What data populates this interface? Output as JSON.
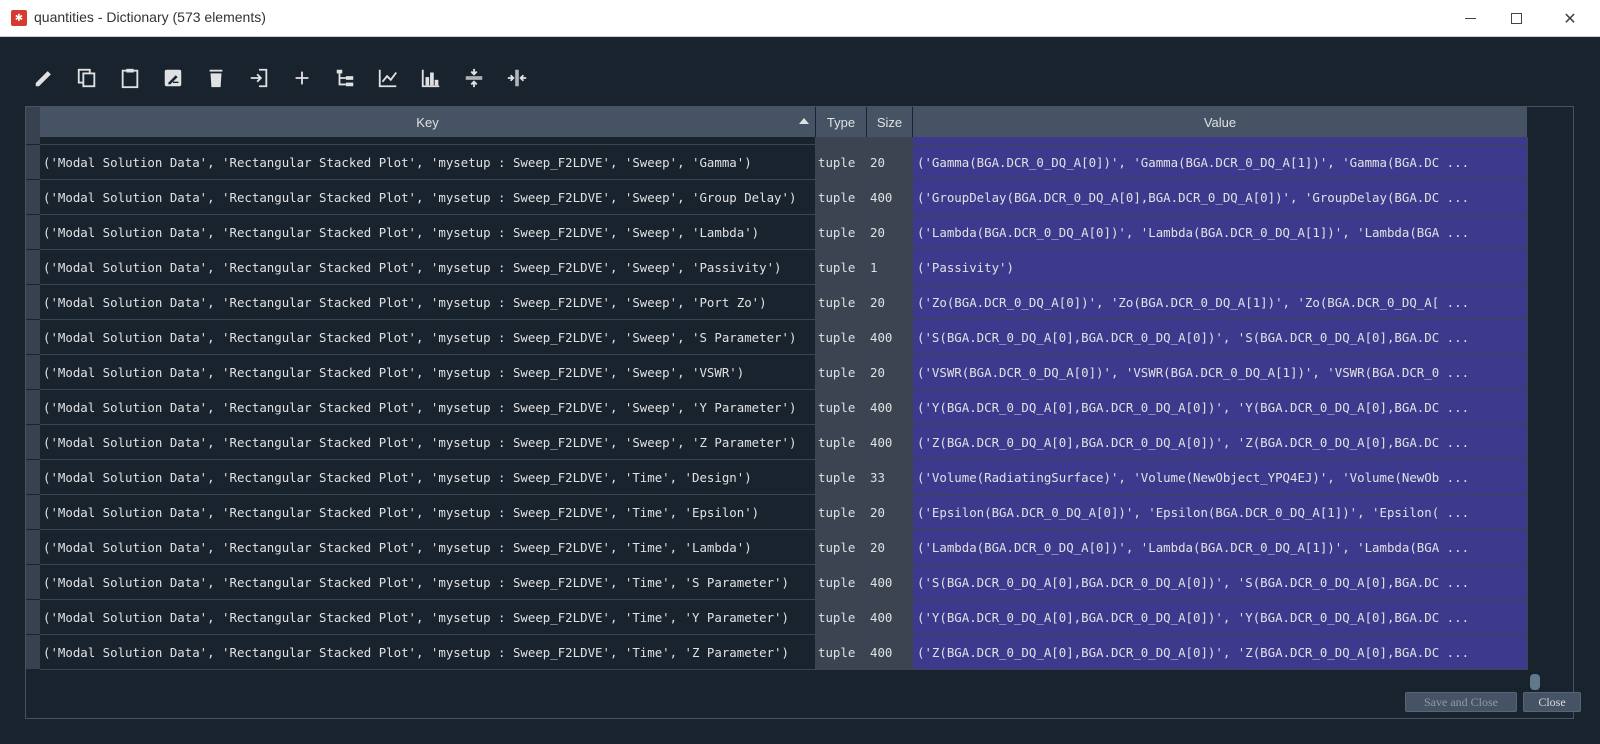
{
  "window": {
    "title": "quantities - Dictionary (573 elements)",
    "icon": "spyder-logo-icon",
    "controls": [
      "minimize",
      "maximize",
      "close"
    ]
  },
  "toolbar": {
    "buttons": [
      {
        "name": "edit",
        "icon": "pencil-icon"
      },
      {
        "name": "copy",
        "icon": "copy-icon"
      },
      {
        "name": "paste",
        "icon": "clipboard-icon"
      },
      {
        "name": "rename",
        "icon": "rename-icon"
      },
      {
        "name": "remove",
        "icon": "trash-icon"
      },
      {
        "name": "insert",
        "icon": "import-icon"
      },
      {
        "name": "add",
        "icon": "plus-icon"
      },
      {
        "name": "tree",
        "icon": "tree-icon"
      },
      {
        "name": "plot",
        "icon": "line-chart-icon"
      },
      {
        "name": "histogram",
        "icon": "histogram-icon"
      },
      {
        "name": "collapse-rows",
        "icon": "vertical-resize-icon"
      },
      {
        "name": "collapse-columns",
        "icon": "horizontal-resize-icon"
      }
    ]
  },
  "table": {
    "columns": [
      "Key",
      "Type",
      "Size",
      "Value"
    ],
    "sort_column": "Key",
    "sort_order": "ascending",
    "rows": [
      {
        "key": "('Modal Solution Data', 'Rectangular Stacked Plot', 'mysetup : Sweep_F2LDVE', 'Sweep', 'Gamma')",
        "type": "tuple",
        "size": "20",
        "value": "('Gamma(BGA.DCR_0_DQ_A[0])', 'Gamma(BGA.DCR_0_DQ_A[1])', 'Gamma(BGA.DC ..."
      },
      {
        "key": "('Modal Solution Data', 'Rectangular Stacked Plot', 'mysetup : Sweep_F2LDVE', 'Sweep', 'Group Delay')",
        "type": "tuple",
        "size": "400",
        "value": "('GroupDelay(BGA.DCR_0_DQ_A[0],BGA.DCR_0_DQ_A[0])', 'GroupDelay(BGA.DC ..."
      },
      {
        "key": "('Modal Solution Data', 'Rectangular Stacked Plot', 'mysetup : Sweep_F2LDVE', 'Sweep', 'Lambda')",
        "type": "tuple",
        "size": "20",
        "value": "('Lambda(BGA.DCR_0_DQ_A[0])', 'Lambda(BGA.DCR_0_DQ_A[1])', 'Lambda(BGA ..."
      },
      {
        "key": "('Modal Solution Data', 'Rectangular Stacked Plot', 'mysetup : Sweep_F2LDVE', 'Sweep', 'Passivity')",
        "type": "tuple",
        "size": "1",
        "value": "('Passivity')"
      },
      {
        "key": "('Modal Solution Data', 'Rectangular Stacked Plot', 'mysetup : Sweep_F2LDVE', 'Sweep', 'Port Zo')",
        "type": "tuple",
        "size": "20",
        "value": "('Zo(BGA.DCR_0_DQ_A[0])', 'Zo(BGA.DCR_0_DQ_A[1])', 'Zo(BGA.DCR_0_DQ_A[ ..."
      },
      {
        "key": "('Modal Solution Data', 'Rectangular Stacked Plot', 'mysetup : Sweep_F2LDVE', 'Sweep', 'S Parameter')",
        "type": "tuple",
        "size": "400",
        "value": "('S(BGA.DCR_0_DQ_A[0],BGA.DCR_0_DQ_A[0])', 'S(BGA.DCR_0_DQ_A[0],BGA.DC ..."
      },
      {
        "key": "('Modal Solution Data', 'Rectangular Stacked Plot', 'mysetup : Sweep_F2LDVE', 'Sweep', 'VSWR')",
        "type": "tuple",
        "size": "20",
        "value": "('VSWR(BGA.DCR_0_DQ_A[0])', 'VSWR(BGA.DCR_0_DQ_A[1])', 'VSWR(BGA.DCR_0 ..."
      },
      {
        "key": "('Modal Solution Data', 'Rectangular Stacked Plot', 'mysetup : Sweep_F2LDVE', 'Sweep', 'Y Parameter')",
        "type": "tuple",
        "size": "400",
        "value": "('Y(BGA.DCR_0_DQ_A[0],BGA.DCR_0_DQ_A[0])', 'Y(BGA.DCR_0_DQ_A[0],BGA.DC ..."
      },
      {
        "key": "('Modal Solution Data', 'Rectangular Stacked Plot', 'mysetup : Sweep_F2LDVE', 'Sweep', 'Z Parameter')",
        "type": "tuple",
        "size": "400",
        "value": "('Z(BGA.DCR_0_DQ_A[0],BGA.DCR_0_DQ_A[0])', 'Z(BGA.DCR_0_DQ_A[0],BGA.DC ..."
      },
      {
        "key": "('Modal Solution Data', 'Rectangular Stacked Plot', 'mysetup : Sweep_F2LDVE', 'Time', 'Design')",
        "type": "tuple",
        "size": "33",
        "value": "('Volume(RadiatingSurface)', 'Volume(NewObject_YPQ4EJ)', 'Volume(NewOb ..."
      },
      {
        "key": "('Modal Solution Data', 'Rectangular Stacked Plot', 'mysetup : Sweep_F2LDVE', 'Time', 'Epsilon')",
        "type": "tuple",
        "size": "20",
        "value": "('Epsilon(BGA.DCR_0_DQ_A[0])', 'Epsilon(BGA.DCR_0_DQ_A[1])', 'Epsilon( ..."
      },
      {
        "key": "('Modal Solution Data', 'Rectangular Stacked Plot', 'mysetup : Sweep_F2LDVE', 'Time', 'Lambda')",
        "type": "tuple",
        "size": "20",
        "value": "('Lambda(BGA.DCR_0_DQ_A[0])', 'Lambda(BGA.DCR_0_DQ_A[1])', 'Lambda(BGA ..."
      },
      {
        "key": "('Modal Solution Data', 'Rectangular Stacked Plot', 'mysetup : Sweep_F2LDVE', 'Time', 'S Parameter')",
        "type": "tuple",
        "size": "400",
        "value": "('S(BGA.DCR_0_DQ_A[0],BGA.DCR_0_DQ_A[0])', 'S(BGA.DCR_0_DQ_A[0],BGA.DC ..."
      },
      {
        "key": "('Modal Solution Data', 'Rectangular Stacked Plot', 'mysetup : Sweep_F2LDVE', 'Time', 'Y Parameter')",
        "type": "tuple",
        "size": "400",
        "value": "('Y(BGA.DCR_0_DQ_A[0],BGA.DCR_0_DQ_A[0])', 'Y(BGA.DCR_0_DQ_A[0],BGA.DC ..."
      },
      {
        "key": "('Modal Solution Data', 'Rectangular Stacked Plot', 'mysetup : Sweep_F2LDVE', 'Time', 'Z Parameter')",
        "type": "tuple",
        "size": "400",
        "value": "('Z(BGA.DCR_0_DQ_A[0],BGA.DCR_0_DQ_A[0])', 'Z(BGA.DCR_0_DQ_A[0],BGA.DC ..."
      }
    ]
  },
  "footer": {
    "save_label": "Save and Close",
    "close_label": "Close"
  },
  "colors": {
    "background": "#19232d",
    "header": "#455364",
    "value_cell": "#3d3a8e",
    "type_size_cell": "#3b4450",
    "text": "#e0e1e3"
  }
}
